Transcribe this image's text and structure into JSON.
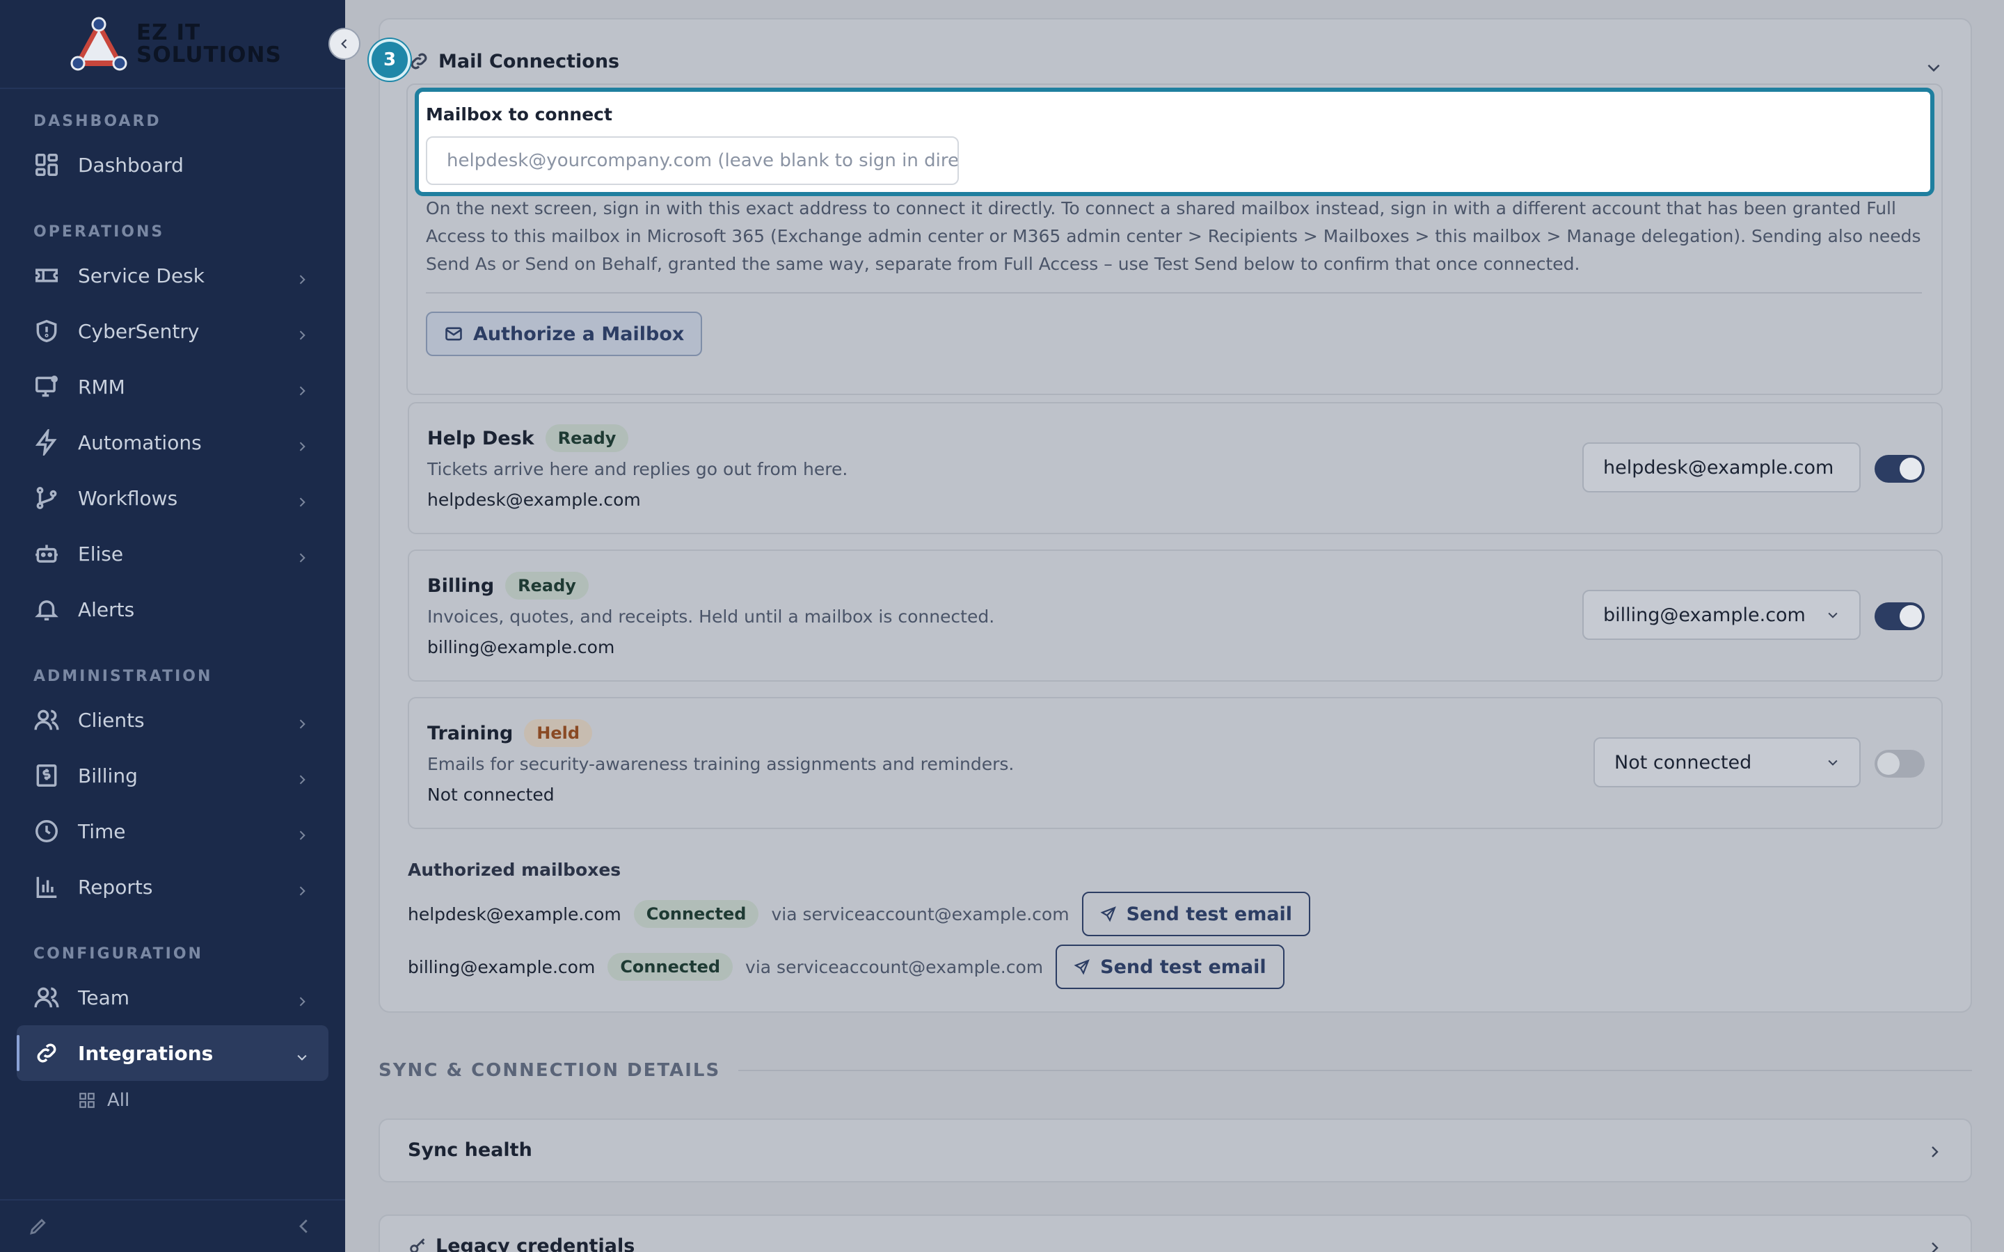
{
  "app": {
    "logo_line1": "EZ IT",
    "logo_line2": "SOLUTIONS"
  },
  "sidebar": {
    "sections": {
      "dashboard": "DASHBOARD",
      "operations": "OPERATIONS",
      "administration": "ADMINISTRATION",
      "configuration": "CONFIGURATION"
    },
    "items": {
      "dashboard": "Dashboard",
      "service_desk": "Service Desk",
      "cybersentry": "CyberSentry",
      "rmm": "RMM",
      "automations": "Automations",
      "workflows": "Workflows",
      "elise": "Elise",
      "alerts": "Alerts",
      "clients": "Clients",
      "billing": "Billing",
      "time": "Time",
      "reports": "Reports",
      "team": "Team",
      "integrations": "Integrations",
      "all": "All"
    }
  },
  "mail": {
    "title": "Mail Connections",
    "step": "3",
    "mailbox_label": "Mailbox to connect",
    "mailbox_placeholder": "helpdesk@yourcompany.com (leave blank to sign in directly)",
    "help_text": "On the next screen, sign in with this exact address to connect it directly. To connect a shared mailbox instead, sign in with a different account that has been granted Full Access to this mailbox in Microsoft 365 (Exchange admin center or M365 admin center > Recipients > Mailboxes > this mailbox > Manage delegation). Sending also needs Send As or Send on Behalf, granted the same way, separate from Full Access – use Test Send below to confirm that once connected.",
    "authorize_button": "Authorize a Mailbox",
    "rows": [
      {
        "title": "Help Desk",
        "status": "Ready",
        "desc": "Tickets arrive here and replies go out from here.",
        "addr": "helpdesk@example.com",
        "select": "helpdesk@example.com",
        "enabled": true
      },
      {
        "title": "Billing",
        "status": "Ready",
        "desc": "Invoices, quotes, and receipts. Held until a mailbox is connected.",
        "addr": "billing@example.com",
        "select": "billing@example.com",
        "enabled": true
      },
      {
        "title": "Training",
        "status": "Held",
        "desc": "Emails for security-awareness training assignments and reminders.",
        "addr": "Not connected",
        "select": "Not connected",
        "enabled": false
      }
    ],
    "authorized_title": "Authorized mailboxes",
    "authorized": [
      {
        "addr": "helpdesk@example.com",
        "status": "Connected",
        "via": "via serviceaccount@example.com",
        "button": "Send test email"
      },
      {
        "addr": "billing@example.com",
        "status": "Connected",
        "via": "via serviceaccount@example.com",
        "button": "Send test email"
      }
    ]
  },
  "sync": {
    "section_title": "SYNC & CONNECTION DETAILS",
    "sync_health": "Sync health",
    "legacy": "Legacy credentials"
  }
}
